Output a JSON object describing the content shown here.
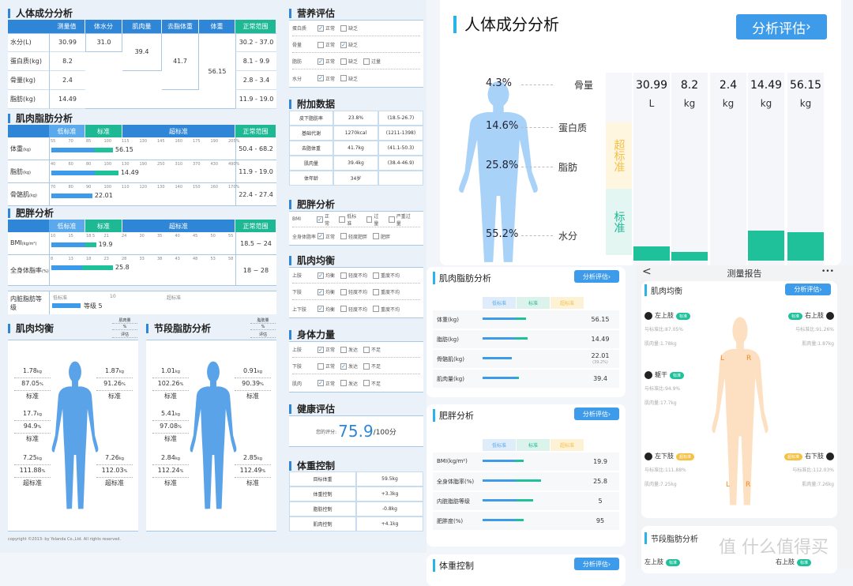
{
  "colors": {
    "primary": "#2f86d6",
    "standard": "#1fb895",
    "over": "#f5c046",
    "figure_blue": "#5aa3e8",
    "figure_orange": "#fde0c2"
  },
  "composition": {
    "title": "人体成分分析",
    "headers": [
      "测量值",
      "体水分",
      "肌肉量",
      "去脂体重",
      "体重",
      "正常范围"
    ],
    "rows": [
      {
        "label": "水分(L)",
        "value": "30.99",
        "range": "30.2 - 37.0"
      },
      {
        "label": "蛋白质(kg)",
        "value": "8.2",
        "range": "8.1 - 9.9"
      },
      {
        "label": "骨量(kg)",
        "value": "2.4",
        "range": "2.8 - 3.4"
      },
      {
        "label": "脂肪(kg)",
        "value": "14.49",
        "range": "11.9 - 19.0"
      }
    ],
    "body_water": "31.0",
    "muscle": "39.4",
    "lean_mass": "41.7",
    "weight": "56.15"
  },
  "muscle_fat": {
    "title": "肌肉脂肪分析",
    "bands": [
      "低标准",
      "标准",
      "超标准",
      "正常范围"
    ],
    "rows": [
      {
        "label": "体重",
        "unit": "(kg)",
        "ticks": [
          "55",
          "70",
          "85",
          "100",
          "115",
          "130",
          "145",
          "160",
          "175",
          "190",
          "205%"
        ],
        "value": "56.15",
        "range": "50.4 - 68.2",
        "bar": 0.33,
        "split": 0.7
      },
      {
        "label": "脂肪",
        "unit": "(kg)",
        "ticks": [
          "40",
          "60",
          "80",
          "100",
          "130",
          "190",
          "250",
          "310",
          "370",
          "430",
          "490%"
        ],
        "value": "14.49",
        "range": "11.9 - 19.0",
        "bar": 0.36,
        "split": 0.65
      },
      {
        "label": "骨骼肌",
        "unit": "(kg)",
        "ticks": [
          "70",
          "80",
          "90",
          "100",
          "110",
          "120",
          "130",
          "140",
          "150",
          "160",
          "170%"
        ],
        "value": "22.01",
        "range": "22.4 - 27.4",
        "bar": 0.22,
        "split": 1
      }
    ]
  },
  "obesity": {
    "title": "肥胖分析",
    "bands": [
      "低标准",
      "标准",
      "超标准",
      "正常范围"
    ],
    "rows": [
      {
        "label": "BMI",
        "unit": "(kg/m²)",
        "ticks": [
          "10",
          "15",
          "18.5",
          "21",
          "24",
          "30",
          "35",
          "40",
          "45",
          "50",
          "55"
        ],
        "value": "19.9",
        "range": "18.5 ~ 24",
        "bar": 0.24,
        "split": 0.75
      },
      {
        "label": "全身体脂率",
        "unit": "(%)",
        "ticks": [
          "8",
          "13",
          "18",
          "23",
          "28",
          "33",
          "38",
          "43",
          "48",
          "53",
          "58"
        ],
        "value": "25.8",
        "range": "18 ~ 28",
        "bar": 0.33,
        "split": 0.5
      }
    ],
    "visceral": {
      "label": "内脏脂肪等级",
      "ticks": [
        "低标准",
        "10",
        "超标准"
      ],
      "value": "等级 5",
      "bar": 0.25
    }
  },
  "balance_panels": [
    {
      "title": "肌肉均衡",
      "legend": [
        "肌肉量",
        "%",
        "评估"
      ],
      "segments": [
        {
          "kg": "1.78",
          "pct": "87.05",
          "eval": "标准"
        },
        {
          "kg": "1.87",
          "pct": "91.26",
          "eval": "标准"
        },
        {
          "kg": "17.7",
          "pct": "94.9",
          "eval": "标准"
        },
        {
          "kg": "7.25",
          "pct": "111.88",
          "eval": "超标准"
        },
        {
          "kg": "7.26",
          "pct": "112.03",
          "eval": "超标准"
        }
      ]
    },
    {
      "title": "节段脂肪分析",
      "legend": [
        "脂肪量",
        "%",
        "评估"
      ],
      "segments": [
        {
          "kg": "1.01",
          "pct": "102.26",
          "eval": "标准"
        },
        {
          "kg": "0.91",
          "pct": "90.39",
          "eval": "标准"
        },
        {
          "kg": "5.41",
          "pct": "97.08",
          "eval": "标准"
        },
        {
          "kg": "2.84",
          "pct": "112.24",
          "eval": "标准"
        },
        {
          "kg": "2.85",
          "pct": "112.49",
          "eval": "标准"
        }
      ]
    }
  ],
  "units": {
    "kg": "kg",
    "pct": "%",
    "L": "L",
    "R": "R"
  },
  "copyright": "copyright ©2013- by Yolanda Co.,Ltd. All rights reserved.",
  "nutrition": {
    "title": "营养评估",
    "rows": [
      {
        "label": "蛋白质",
        "options": [
          {
            "text": "正常",
            "checked": true
          },
          {
            "text": "缺乏",
            "checked": false
          }
        ]
      },
      {
        "label": "骨量",
        "options": [
          {
            "text": "正常",
            "checked": false
          },
          {
            "text": "缺乏",
            "checked": true
          }
        ]
      },
      {
        "label": "脂肪",
        "options": [
          {
            "text": "正常",
            "checked": true
          },
          {
            "text": "缺乏",
            "checked": false
          },
          {
            "text": "过量",
            "checked": false
          }
        ]
      },
      {
        "label": "水分",
        "options": [
          {
            "text": "正常",
            "checked": true
          },
          {
            "text": "缺乏",
            "checked": false
          }
        ]
      }
    ]
  },
  "extra": {
    "title": "附加数据",
    "rows": [
      [
        "皮下脂肪率",
        "23.8%",
        "(18.5-26.7)"
      ],
      [
        "基础代谢",
        "1270kcal",
        "(1211-1398)"
      ],
      [
        "去脂体重",
        "41.7kg",
        "(41.1-50.3)"
      ],
      [
        "肌肉量",
        "39.4kg",
        "(38.4-46.9)"
      ],
      [
        "体年龄",
        "34岁",
        ""
      ]
    ]
  },
  "obesity_check": {
    "title": "肥胖分析",
    "rows": [
      {
        "label": "BMI",
        "options": [
          {
            "text": "正常",
            "checked": true
          },
          {
            "text": "低标准",
            "checked": false
          },
          {
            "text": "过量",
            "checked": false
          },
          {
            "text": "严重过量",
            "checked": false
          }
        ]
      },
      {
        "label": "全身体脂率",
        "options": [
          {
            "text": "正常",
            "checked": true
          },
          {
            "text": "轻度肥胖",
            "checked": false
          },
          {
            "text": "肥胖",
            "checked": false
          }
        ]
      }
    ]
  },
  "balance_check": {
    "title": "肌肉均衡",
    "rows": [
      {
        "label": "上肢",
        "options": [
          {
            "text": "均衡",
            "checked": true
          },
          {
            "text": "轻度不均",
            "checked": false
          },
          {
            "text": "重度不均",
            "checked": false
          }
        ]
      },
      {
        "label": "下肢",
        "options": [
          {
            "text": "均衡",
            "checked": true
          },
          {
            "text": "轻度不均",
            "checked": false
          },
          {
            "text": "重度不均",
            "checked": false
          }
        ]
      },
      {
        "label": "上下肢",
        "options": [
          {
            "text": "均衡",
            "checked": true
          },
          {
            "text": "轻度不均",
            "checked": false
          },
          {
            "text": "重度不均",
            "checked": false
          }
        ]
      }
    ]
  },
  "strength": {
    "title": "身体力量",
    "rows": [
      {
        "label": "上肢",
        "options": [
          {
            "text": "正常",
            "checked": true
          },
          {
            "text": "发达",
            "checked": false
          },
          {
            "text": "不足",
            "checked": false
          }
        ]
      },
      {
        "label": "下肢",
        "options": [
          {
            "text": "正常",
            "checked": false
          },
          {
            "text": "发达",
            "checked": true
          },
          {
            "text": "不足",
            "checked": false
          }
        ]
      },
      {
        "label": "肌肉",
        "options": [
          {
            "text": "正常",
            "checked": true
          },
          {
            "text": "发达",
            "checked": false
          },
          {
            "text": "不足",
            "checked": false
          }
        ]
      }
    ]
  },
  "health": {
    "title": "健康评估",
    "label": "您的评分:",
    "score": "75.9",
    "suffix": "/100分"
  },
  "weight_control": {
    "title": "体重控制",
    "rows": [
      [
        "目标体重",
        "59.5kg"
      ],
      [
        "体重控制",
        "+3.3kg"
      ],
      [
        "脂肪控制",
        "-0.8kg"
      ],
      [
        "肌肉控制",
        "+4.1kg"
      ]
    ]
  },
  "app_composition": {
    "title": "人体成分分析",
    "button": "分析评估",
    "parts": [
      {
        "pct": "4.3%",
        "name": "骨量"
      },
      {
        "pct": "14.6%",
        "name": "蛋白质"
      },
      {
        "pct": "25.8%",
        "name": "脂肪"
      },
      {
        "pct": "55.2%",
        "name": "水分"
      }
    ],
    "levels": [
      "超标准",
      "标准"
    ],
    "columns": [
      {
        "value": "30.99",
        "unit": "L",
        "level": 0.1
      },
      {
        "value": "8.2",
        "unit": "kg",
        "level": 0.06
      },
      {
        "value": "2.4",
        "unit": "kg",
        "level": 0
      },
      {
        "value": "14.49",
        "unit": "kg",
        "level": 0.21
      },
      {
        "value": "56.15",
        "unit": "kg",
        "level": 0.2
      }
    ]
  },
  "app_cards": [
    {
      "title": "肌肉脂肪分析",
      "button": "分析评估",
      "bands": [
        "低标准",
        "标准",
        "超标准"
      ],
      "rows": [
        {
          "label": "体重(kg)",
          "value": "56.15",
          "bar": 0.5,
          "split": 0.75
        },
        {
          "label": "脂肪(kg)",
          "value": "14.49",
          "bar": 0.52,
          "split": 0.72
        },
        {
          "label": "骨骼肌(kg)",
          "value": "22.01",
          "sub": "(39.2%)",
          "bar": 0.34,
          "split": 1
        },
        {
          "label": "肌肉量(kg)",
          "value": "39.4",
          "bar": 0.42,
          "split": 0.93
        }
      ]
    },
    {
      "title": "肥胖分析",
      "button": "分析评估",
      "bands": [
        "低标准",
        "标准",
        "超标准"
      ],
      "rows": [
        {
          "label": "BMI(kg/m²)",
          "value": "19.9",
          "bar": 0.47,
          "split": 0.78
        },
        {
          "label": "全身体脂率(%)",
          "value": "25.8",
          "bar": 0.67,
          "split": 0.57
        },
        {
          "label": "内脏脂肪等级",
          "value": "5",
          "bar": 0.58,
          "split": 0.67
        },
        {
          "label": "肥胖度(%)",
          "value": "95",
          "bar": 0.47,
          "split": 0.8
        }
      ]
    },
    {
      "title": "体重控制",
      "button": "分析评估"
    }
  ],
  "phone": {
    "header": "测量报告",
    "back": "<",
    "more": "•••",
    "section": "肌肉均衡",
    "button": "分析评估",
    "ratio_label": "与标准比:",
    "muscle_label": "肌肉量:",
    "segments": [
      {
        "name": "左上肢",
        "tag": "标准",
        "ratio": "87.05%",
        "muscle": "1.78kg",
        "over": false
      },
      {
        "name": "右上肢",
        "tag": "标准",
        "ratio": "91.26%",
        "muscle": "1.87kg",
        "over": false
      },
      {
        "name": "躯干",
        "tag": "标准",
        "ratio": "94.9%",
        "muscle": "17.7kg",
        "over": false
      },
      {
        "name": "左下肢",
        "tag": "超标准",
        "ratio": "111.88%",
        "muscle": "7.25kg",
        "over": true
      },
      {
        "name": "右下肢",
        "tag": "超标准",
        "ratio": "112.03%",
        "muscle": "7.26kg",
        "over": true
      }
    ],
    "section2": "节段脂肪分析",
    "section2_items": [
      {
        "name": "左上肢",
        "tag": "标准"
      },
      {
        "name": "右上肢",
        "tag": "标准"
      }
    ]
  },
  "watermark": "值 什么值得买"
}
